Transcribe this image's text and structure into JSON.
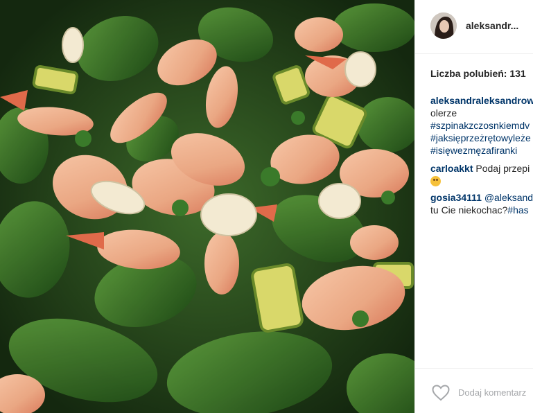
{
  "post": {
    "username": "aleksandr...",
    "likes_label": "Liczba polubień: 131",
    "caption_author": "aleksandraleksandrow",
    "caption_lines": [
      "olerze"
    ],
    "hashtags": [
      "#szpinakzczosnkiemdv",
      "#jaksięprzeżrętowyleże",
      "#isięwezmęzafiranki"
    ]
  },
  "comments": [
    {
      "author": "carloakkt",
      "text": "Podaj przepi",
      "emoji": "smiling-face-icon"
    },
    {
      "author": "gosia34111",
      "mention": "@aleksandr",
      "text2": "tu Cie niekochac?",
      "hashtag": "#has"
    }
  ],
  "footer": {
    "heart_icon": "heart-icon",
    "add_comment_placeholder": "Dodaj komentarz"
  },
  "colors": {
    "link": "#003569",
    "text": "#262626",
    "muted": "#a5a7aa"
  }
}
